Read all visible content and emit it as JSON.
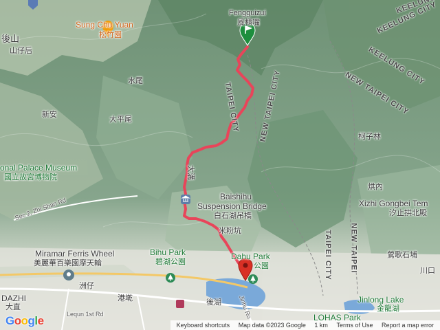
{
  "map": {
    "places": [
      {
        "id": "fengguizui-en",
        "text": "Fengguizui",
        "cls": "en"
      },
      {
        "id": "fengguizui-zh",
        "text": "風櫃嘴",
        "cls": ""
      },
      {
        "id": "sungchuyuan-en",
        "text": "Sung Chu Yuan",
        "cls": "en orange"
      },
      {
        "id": "sungchuyuan-zh",
        "text": "松竹園",
        "cls": "orange"
      },
      {
        "id": "houshan",
        "text": "後山",
        "cls": "big"
      },
      {
        "id": "shanzihou",
        "text": "山仔后",
        "cls": ""
      },
      {
        "id": "shuiwei",
        "text": "水尾",
        "cls": ""
      },
      {
        "id": "xinan",
        "text": "新安",
        "cls": ""
      },
      {
        "id": "dapingwei",
        "text": "大平尾",
        "cls": ""
      },
      {
        "id": "palace-en",
        "text": "onal Palace Museum",
        "cls": "en green"
      },
      {
        "id": "palace-zh",
        "text": "國立故宮博物院",
        "cls": "green"
      },
      {
        "id": "zhishan",
        "text": "Sec 2, Zhi Shan Rd",
        "cls": "road"
      },
      {
        "id": "baishihu-en1",
        "text": "Baishihu",
        "cls": "en"
      },
      {
        "id": "baishihu-en2",
        "text": "Suspension Bridge",
        "cls": "en"
      },
      {
        "id": "baishihu-zh",
        "text": "白石湖吊橋",
        "cls": ""
      },
      {
        "id": "dagou",
        "text": "大溝",
        "cls": ""
      },
      {
        "id": "shifengkeng",
        "text": "米粉坑",
        "cls": ""
      },
      {
        "id": "miramar-en",
        "text": "Miramar Ferris Wheel",
        "cls": "en"
      },
      {
        "id": "miramar-zh",
        "text": "美麗華百樂園摩天輪",
        "cls": ""
      },
      {
        "id": "bihu-en",
        "text": "Bihu Park",
        "cls": "en green"
      },
      {
        "id": "bihu-zh",
        "text": "碧湖公園",
        "cls": "green"
      },
      {
        "id": "dahu-en",
        "text": "Dahu Park",
        "cls": "en green"
      },
      {
        "id": "dahu-zh",
        "text": "公園",
        "cls": "green"
      },
      {
        "id": "zhouzi",
        "text": "洲仔",
        "cls": ""
      },
      {
        "id": "dazhi-en",
        "text": "DAZHI",
        "cls": "en"
      },
      {
        "id": "dazhi-zh",
        "text": "大直",
        "cls": ""
      },
      {
        "id": "gangqian",
        "text": "港墘",
        "cls": ""
      },
      {
        "id": "houhu",
        "text": "後湖",
        "cls": ""
      },
      {
        "id": "lequn",
        "text": "Lequn 1st Rd",
        "cls": "road"
      },
      {
        "id": "jinhu",
        "text": "Jinhu Ro",
        "cls": "road"
      },
      {
        "id": "kezilin",
        "text": "柯子林",
        "cls": ""
      },
      {
        "id": "fengnei",
        "text": "烘內",
        "cls": ""
      },
      {
        "id": "xizhi-en",
        "text": "Xizhi Gongbei Tem",
        "cls": "en"
      },
      {
        "id": "xizhi-zh",
        "text": "汐止拱北殿",
        "cls": ""
      },
      {
        "id": "yingge",
        "text": "鶯歌石埔",
        "cls": ""
      },
      {
        "id": "jinlong-en",
        "text": "Jinlong Lake",
        "cls": "en green"
      },
      {
        "id": "jinlong-zh",
        "text": "金龍湖",
        "cls": "green"
      },
      {
        "id": "lohas",
        "text": "LOHAS Park",
        "cls": "en green"
      },
      {
        "id": "chuankou",
        "text": "川口",
        "cls": ""
      }
    ],
    "cities": [
      {
        "id": "taipei-city-1",
        "text": "TAIPEI CITY"
      },
      {
        "id": "newtaipei-1",
        "text": "NEW TAIPEI CITY"
      },
      {
        "id": "keelung-1",
        "text": "KEELUNG CITY"
      },
      {
        "id": "keelung-2",
        "text": "KEELUNG CITY"
      },
      {
        "id": "keelung-3",
        "text": "KEELUNG"
      },
      {
        "id": "newtaipei-2",
        "text": "NEW TAIPEI CITY"
      },
      {
        "id": "taipei-city-2",
        "text": "TAIPEI CITY"
      },
      {
        "id": "newtaipei-3",
        "text": "NEW TAIPEI"
      }
    ],
    "route_color": "#e8455a",
    "start_marker_color": "#1e8e3e",
    "end_marker_color": "#d93025"
  },
  "attribution": {
    "keyboard": "Keyboard shortcuts",
    "mapdata": "Map data ©2023 Google",
    "scale": "1 km",
    "terms": "Terms of Use",
    "report": "Report a map error"
  },
  "logo": "Google"
}
